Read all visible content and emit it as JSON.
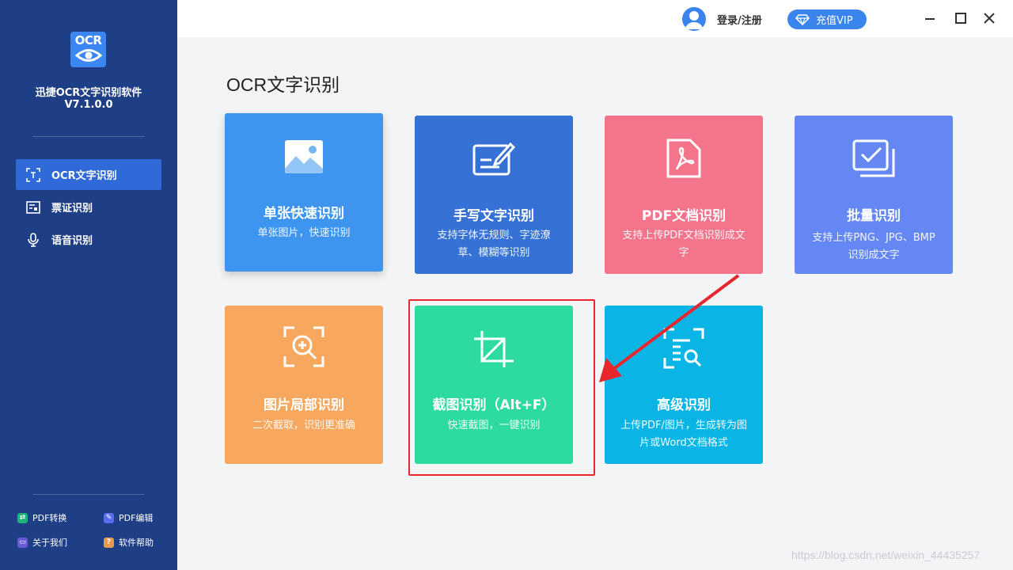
{
  "app": {
    "logo_text": "OCR",
    "name": "迅捷OCR文字识别软件",
    "version": "V7.1.0.0"
  },
  "sidebar": {
    "items": [
      {
        "label": "OCR文字识别",
        "icon": "ocr-scan-icon",
        "active": true
      },
      {
        "label": "票证识别",
        "icon": "ticket-icon",
        "active": false
      },
      {
        "label": "语音识别",
        "icon": "microphone-icon",
        "active": false
      }
    ],
    "footer": [
      {
        "label": "PDF转换",
        "icon": "pdf-convert-icon",
        "color": "#1fb37c"
      },
      {
        "label": "PDF编辑",
        "icon": "pdf-edit-icon",
        "color": "#5b6cf0"
      },
      {
        "label": "关于我们",
        "icon": "about-icon",
        "color": "#6a5ad6"
      },
      {
        "label": "软件帮助",
        "icon": "help-icon",
        "color": "#e89a4a"
      }
    ]
  },
  "topbar": {
    "login_label": "登录/注册",
    "vip_label": "充值VIP"
  },
  "main": {
    "title": "OCR文字识别",
    "cards": [
      {
        "title": "单张快速识别",
        "desc": "单张图片，快速识别",
        "icon": "image-icon",
        "color": "#3d95f0"
      },
      {
        "title": "手写文字识别",
        "desc": "支持字体无规则、字迹潦草、模糊等识别",
        "icon": "handwriting-icon",
        "color": "#3671d6"
      },
      {
        "title": "PDF文档识别",
        "desc": "支持上传PDF文档识别成文字",
        "icon": "pdf-icon",
        "color": "#f4748b"
      },
      {
        "title": "批量识别",
        "desc": "支持上传PNG、JPG、BMP识别成文字",
        "icon": "batch-icon",
        "color": "#6487f4"
      },
      {
        "title": "图片局部识别",
        "desc": "二次截取，识别更准确",
        "icon": "zoom-in-icon",
        "color": "#f7a75e"
      },
      {
        "title": "截图识别（Alt+F）",
        "desc": "快速截图，一键识别",
        "icon": "crop-icon",
        "color": "#2edb9f"
      },
      {
        "title": "高级识别",
        "desc": "上传PDF/图片，生成转为图片或Word文档格式",
        "icon": "advanced-search-icon",
        "color": "#0ab5e6"
      }
    ]
  },
  "watermark": "https://blog.csdn.net/weixin_44435257",
  "colors": {
    "sidebar": "#1e3f85",
    "accent": "#3a84ee",
    "highlight": "#e8262c"
  }
}
